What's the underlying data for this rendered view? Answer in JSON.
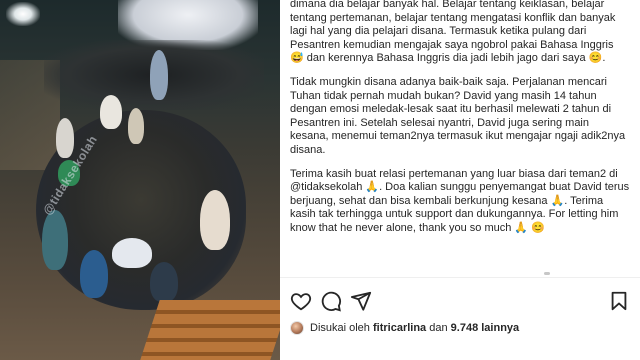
{
  "post": {
    "watermark": "@tidaksekolah",
    "caption": [
      "dimana dia belajar banyak hal. Belajar tentang keiklasan, belajar tentang pertemanan, belajar tentang mengatasi konflik dan banyak lagi hal yang dia pelajari disana. Termasuk ketika pulang dari Pesantren kemudian mengajak saya ngobrol pakai Bahasa Inggris 😅 dan kerennya Bahasa Inggris dia jadi lebih jago dari saya 😊.",
      "Tidak mungkin disana adanya baik-baik saja. Perjalanan mencari Tuhan tidak pernah mudah bukan? David yang masih 14 tahun dengan emosi meledak-lesak saat itu berhasil melewati 2 tahun di Pesantren ini. Setelah selesai nyantri, David juga sering main kesana, menemui teman2nya termasuk ikut mengajar ngaji adik2nya disana.",
      "Terima kasih buat relasi pertemanan yang luar biasa dari teman2 di @tidaksekolah 🙏. Doa kalian sunggu penyemangat buat David terus berjuang, sehat dan bisa kembali berkunjung kesana 🙏. Terima kasih tak terhingga untuk support dan dukungannya. For letting him know that he never alone, thank you so much 🙏 😊"
    ]
  },
  "actions": {
    "like_icon": "heart-icon",
    "comment_icon": "comment-icon",
    "share_icon": "share-icon",
    "save_icon": "bookmark-icon"
  },
  "likes": {
    "prefix": "Disukai oleh",
    "user": "fitricarlina",
    "connector": "dan",
    "count": "9.748",
    "suffix": "lainnya"
  },
  "colors": {
    "text": "#262626",
    "divider": "#efefef",
    "icon": "#262626"
  }
}
